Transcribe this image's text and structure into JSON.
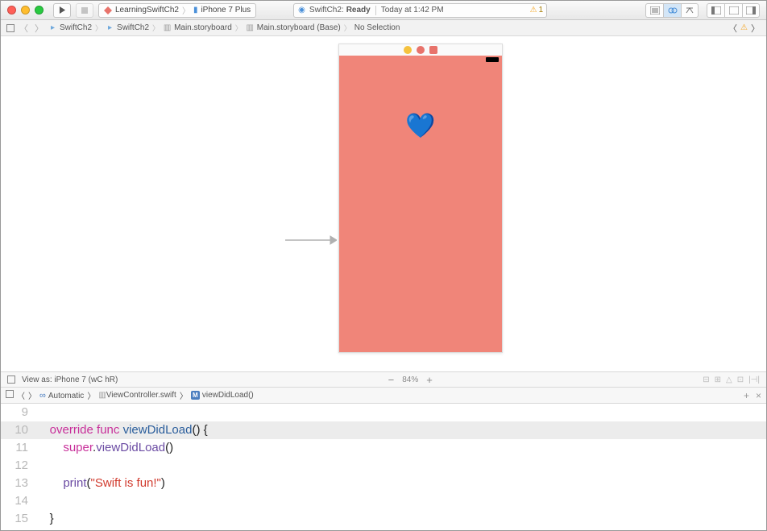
{
  "toolbar": {
    "scheme_target": "LearningSwiftCh2",
    "scheme_device": "iPhone 7 Plus",
    "status_project": "SwiftCh2:",
    "status_state": "Ready",
    "status_time": "Today at 1:42 PM",
    "warning_count": "1"
  },
  "breadcrumb": {
    "items": [
      "SwiftCh2",
      "SwiftCh2",
      "Main.storyboard",
      "Main.storyboard (Base)",
      "No Selection"
    ]
  },
  "canvas": {
    "heart_emoji": "💙"
  },
  "viewas": {
    "label": "View as: iPhone 7 (wC hR)",
    "zoom": "84%"
  },
  "jumpbar": {
    "mode": "Automatic",
    "file": "ViewController.swift",
    "method": "viewDidLoad()"
  },
  "code": {
    "lines": [
      {
        "n": "9",
        "html": ""
      },
      {
        "n": "10",
        "html": "    <span class='kw'>override</span> <span class='kw'>func</span> <span class='fn'>viewDidLoad</span>() {",
        "hl": true
      },
      {
        "n": "11",
        "html": "        <span class='kw'>super</span>.<span class='sup'>viewDidLoad</span>()"
      },
      {
        "n": "12",
        "html": ""
      },
      {
        "n": "13",
        "html": "        <span class='sup'>print</span>(<span class='str'>\"Swift is fun!\"</span>)"
      },
      {
        "n": "14",
        "html": ""
      },
      {
        "n": "15",
        "html": "    }"
      }
    ]
  }
}
